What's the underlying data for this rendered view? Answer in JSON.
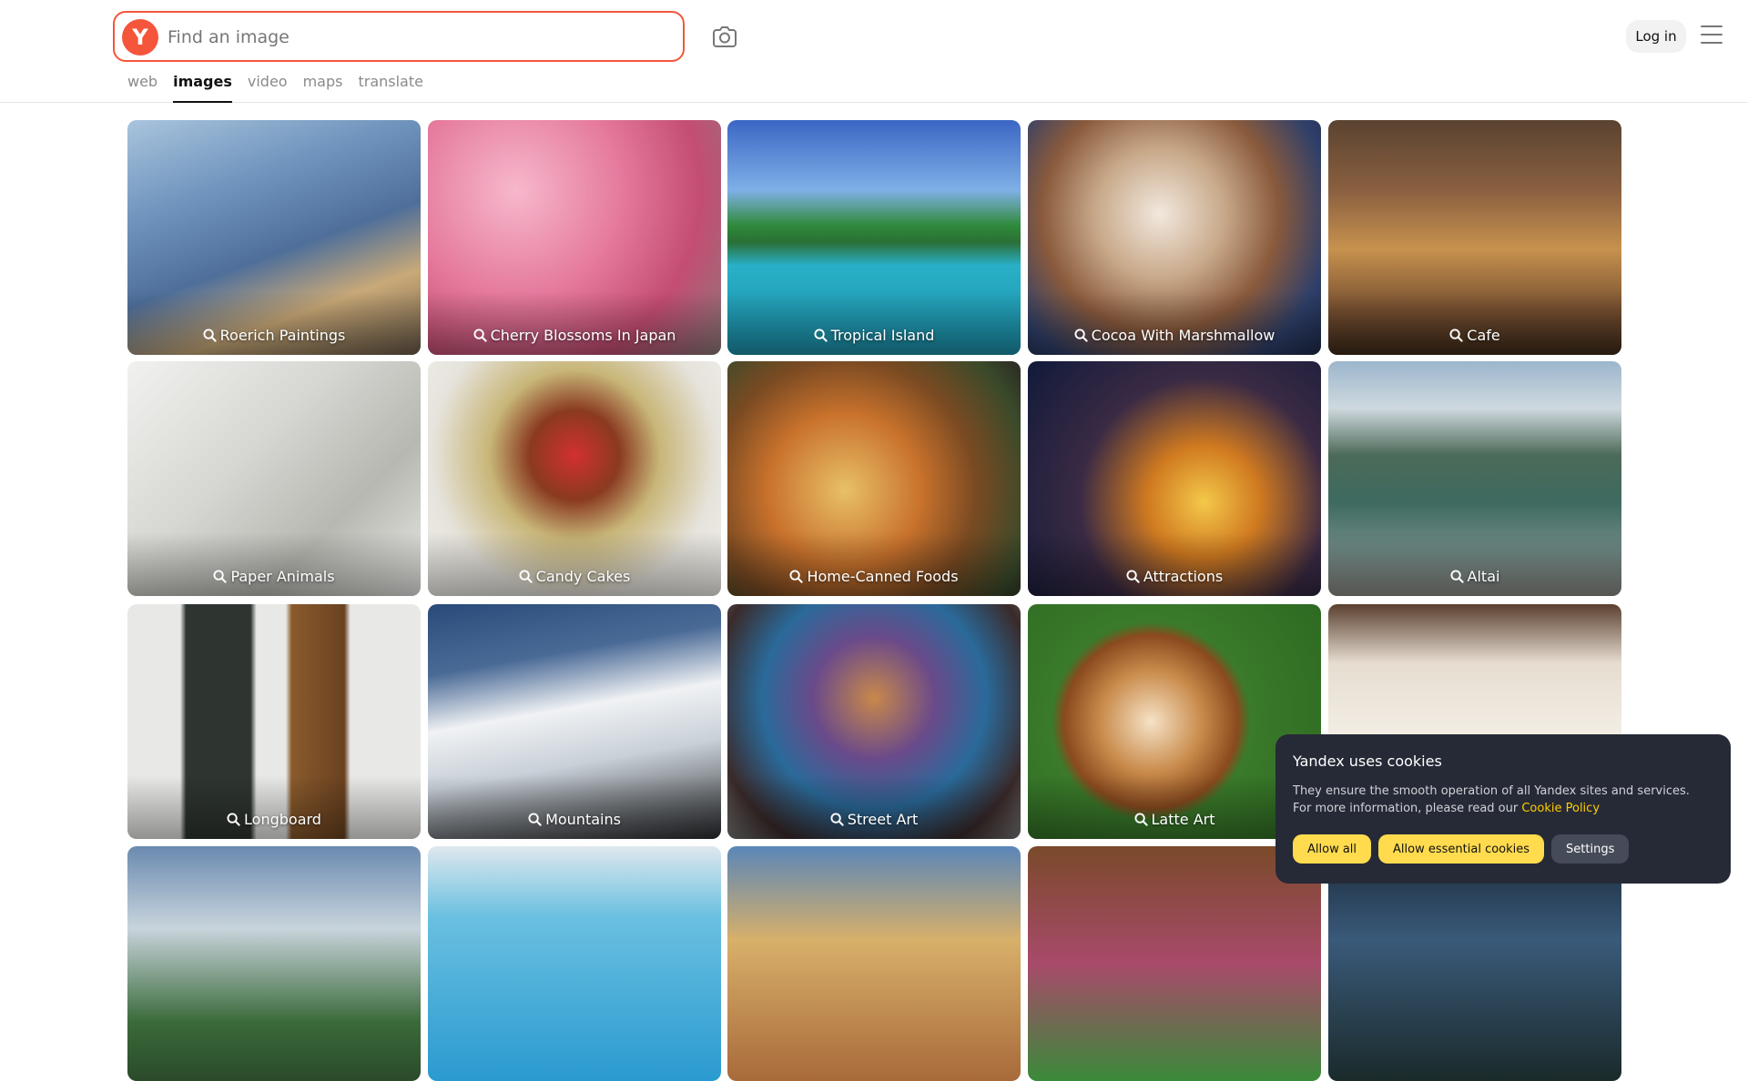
{
  "search": {
    "placeholder": "Find an image",
    "logo_letter": "Y"
  },
  "header": {
    "login_label": "Log in"
  },
  "tabs": [
    {
      "label": "web",
      "active": false
    },
    {
      "label": "images",
      "active": true
    },
    {
      "label": "video",
      "active": false
    },
    {
      "label": "maps",
      "active": false
    },
    {
      "label": "translate",
      "active": false
    }
  ],
  "tiles": [
    {
      "label": "Roerich Paintings",
      "theme": "mountain-painting"
    },
    {
      "label": "Cherry Blossoms In Japan",
      "theme": "pink-trees"
    },
    {
      "label": "Tropical Island",
      "theme": "island"
    },
    {
      "label": "Cocoa With Marshmallow",
      "theme": "cocoa"
    },
    {
      "label": "Cafe",
      "theme": "cafe"
    },
    {
      "label": "Paper Animals",
      "theme": "paper"
    },
    {
      "label": "Candy Cakes",
      "theme": "cake"
    },
    {
      "label": "Home-Canned Foods",
      "theme": "jars"
    },
    {
      "label": "Attractions",
      "theme": "ferris"
    },
    {
      "label": "Altai",
      "theme": "lake"
    },
    {
      "label": "Longboard",
      "theme": "longboard"
    },
    {
      "label": "Mountains",
      "theme": "snow-peak"
    },
    {
      "label": "Street Art",
      "theme": "mural"
    },
    {
      "label": "Latte Art",
      "theme": "latte"
    },
    {
      "label": "",
      "theme": "interior"
    },
    {
      "label": "",
      "theme": "valley"
    },
    {
      "label": "",
      "theme": "pool"
    },
    {
      "label": "",
      "theme": "town"
    },
    {
      "label": "",
      "theme": "cocktail"
    },
    {
      "label": "",
      "theme": "forest"
    }
  ],
  "cookie": {
    "title": "Yandex uses cookies",
    "text": "They ensure the smooth operation of all Yandex sites and services. For more information, please read our ",
    "link": "Cookie Policy",
    "allow_all": "Allow all",
    "allow_essential": "Allow essential cookies",
    "settings": "Settings"
  },
  "colors": {
    "accent": "#f4553b",
    "banner_bg": "#262a36",
    "banner_button": "#ffdb4d",
    "banner_link": "#ffcc00"
  }
}
